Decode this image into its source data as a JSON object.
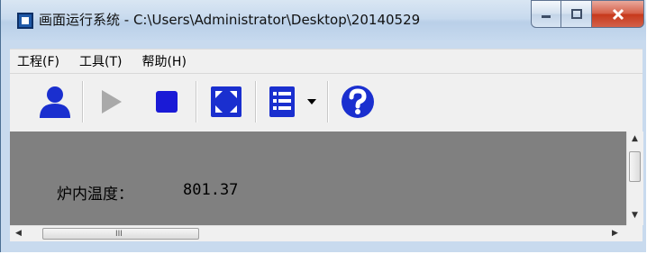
{
  "window": {
    "title": "画面运行系统 - C:\\Users\\Administrator\\Desktop\\20140529",
    "controls": {
      "minimize": "minimize",
      "maximize": "maximize",
      "close": "close"
    }
  },
  "menubar": {
    "items": [
      {
        "label": "工程(F)"
      },
      {
        "label": "工具(T)"
      },
      {
        "label": "帮助(H)"
      }
    ]
  },
  "toolbar": {
    "buttons": [
      {
        "icon": "user-icon",
        "color": "#1a2fcf"
      },
      {
        "icon": "play-icon",
        "color": "#a9a9a9",
        "disabled": true
      },
      {
        "icon": "stop-icon",
        "color": "#1a1ad6"
      },
      {
        "icon": "fullscreen-icon",
        "color": "#1a2fcf"
      },
      {
        "icon": "list-icon",
        "color": "#1a2fcf"
      },
      {
        "icon": "dropdown-arrow-icon",
        "color": "#000000"
      },
      {
        "icon": "help-icon",
        "color": "#1a2fcf"
      }
    ]
  },
  "content": {
    "background": "#808080",
    "temperature_label": "炉内温度：",
    "temperature_value": "801.37"
  },
  "scrollbars": {
    "horizontal_grip": "III"
  }
}
